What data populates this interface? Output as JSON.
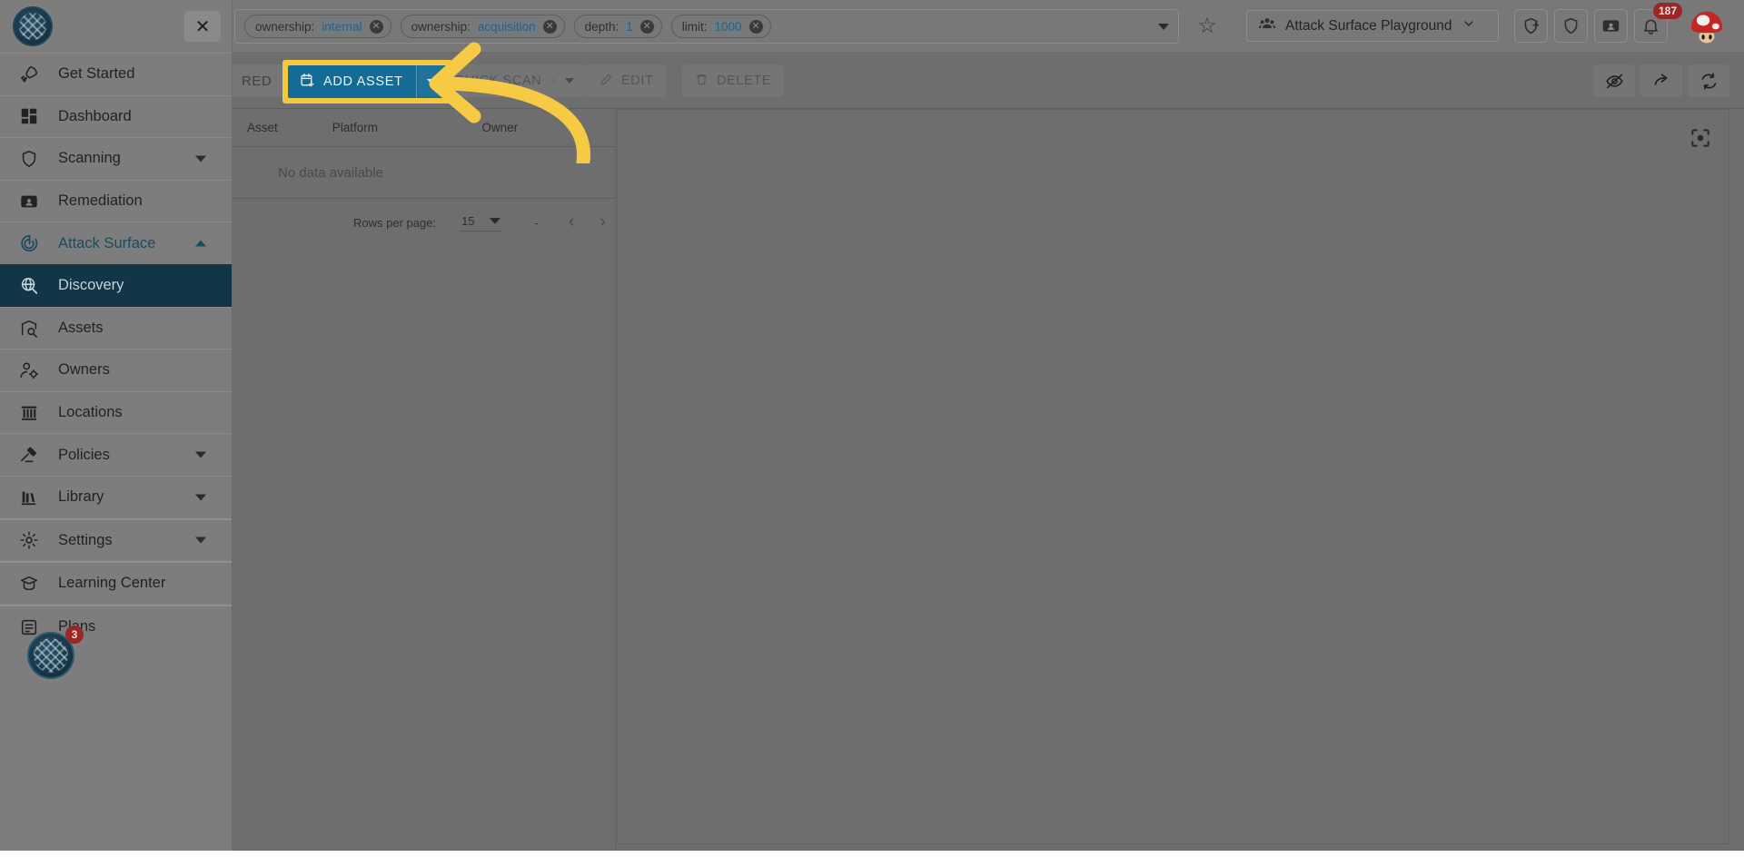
{
  "theme": {
    "accent_blue": "#136b96",
    "highlight_yellow": "#f5c842",
    "active_nav_bg": "#123648",
    "badge_red": "#9a2626",
    "overlay_gray": "#7d7d7d"
  },
  "topbar": {
    "filters": [
      {
        "key": "ownership:",
        "value": "internal",
        "remove_icon": "close-circle-icon"
      },
      {
        "key": "ownership:",
        "value": "acquisition",
        "remove_icon": "close-circle-icon"
      },
      {
        "key": "depth:",
        "value": "1",
        "remove_icon": "close-circle-icon"
      },
      {
        "key": "limit:",
        "value": "1000",
        "remove_icon": "close-circle-icon"
      }
    ],
    "dropdown_icon": "chevron-down-icon",
    "favorite_icon": "star-icon",
    "org_selector": {
      "icon": "people-group-icon",
      "label": "Attack Surface Playground",
      "chevron": "chevron-down-icon"
    },
    "actions": [
      {
        "icon": "shield-plus-icon",
        "name": "add-protection-button"
      },
      {
        "icon": "shield-icon",
        "name": "security-button"
      },
      {
        "icon": "ticket-icon",
        "name": "tickets-button"
      },
      {
        "icon": "bell-icon",
        "name": "notifications-button"
      }
    ],
    "notification_count": "187",
    "avatar_alt": "user-avatar"
  },
  "sidebar": {
    "logo_alt": "company-logo",
    "close_icon": "close-icon",
    "items": [
      {
        "label": "Get Started",
        "icon": "rocket-icon",
        "state": "normal"
      },
      {
        "label": "Dashboard",
        "icon": "dashboard-icon",
        "state": "normal"
      },
      {
        "label": "Scanning",
        "icon": "shield-icon",
        "state": "collapsible"
      },
      {
        "label": "Remediation",
        "icon": "id-card-icon",
        "state": "normal"
      },
      {
        "label": "Attack Surface",
        "icon": "target-icon",
        "state": "expanded"
      },
      {
        "label": "Discovery",
        "icon": "globe-search-icon",
        "state": "active"
      },
      {
        "label": "Assets",
        "icon": "asset-search-icon",
        "state": "normal"
      },
      {
        "label": "Owners",
        "icon": "user-gear-icon",
        "state": "normal"
      },
      {
        "label": "Locations",
        "icon": "building-icon",
        "state": "normal"
      },
      {
        "label": "Policies",
        "icon": "gavel-icon",
        "state": "collapsible"
      },
      {
        "label": "Library",
        "icon": "books-icon",
        "state": "collapsible"
      },
      {
        "label": "Settings",
        "icon": "gear-icon",
        "state": "collapsible"
      },
      {
        "label": "Learning Center",
        "icon": "graduation-cap-icon",
        "state": "normal"
      },
      {
        "label": "Plans",
        "icon": "document-list-icon",
        "state": "normal"
      }
    ],
    "floating_widget": {
      "icon": "company-logo",
      "badge": "3"
    }
  },
  "toolbar": {
    "filtered_button_label": "RED",
    "add_asset_label": "ADD ASSET",
    "add_asset_icon": "calendar-plus-icon",
    "add_asset_split_icon": "caret-down-icon",
    "quick_scan_label": "QUICK SCAN",
    "quick_scan_icon": "shield-icon",
    "quick_scan_split_icon": "caret-down-icon",
    "edit_label": "EDIT",
    "edit_icon": "pencil-icon",
    "delete_label": "DELETE",
    "delete_icon": "trash-icon",
    "right_actions": [
      {
        "icon": "eye-off-icon",
        "name": "hide-button"
      },
      {
        "icon": "share-icon",
        "name": "share-button"
      },
      {
        "icon": "refresh-icon",
        "name": "refresh-button"
      }
    ]
  },
  "table": {
    "columns": [
      "Asset",
      "Platform",
      "Owner"
    ],
    "empty_message": "No data available",
    "pagination": {
      "rows_per_page_label": "Rows per page:",
      "rows_per_page_value": "15",
      "rows_per_page_icon": "caret-down-icon",
      "range_text": "-",
      "prev_icon": "chevron-left-icon",
      "next_icon": "chevron-right-icon"
    }
  },
  "graph_panel": {
    "recenter_icon": "focus-target-icon"
  },
  "annotation": {
    "type": "curved-arrow",
    "color": "#f7ca45",
    "points_to": "add-asset-button"
  }
}
